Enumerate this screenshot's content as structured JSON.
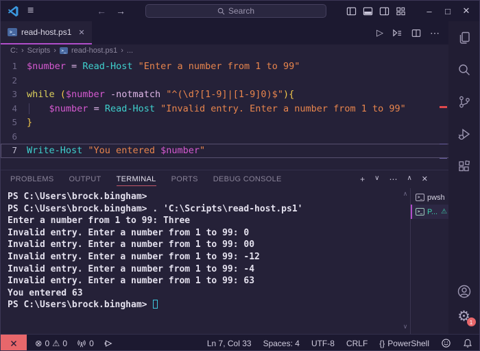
{
  "icons": {
    "menu": "≡",
    "back": "←",
    "forward": "→",
    "minimize": "–",
    "maximize": "□",
    "close": "✕",
    "play": "▷",
    "ellipsis": "⋯",
    "plus": "+",
    "chevron_down": "∨",
    "chevron_up": "∧",
    "error": "⊗",
    "warning": "⚠",
    "gear": "⚙",
    "braces": "{}",
    "sep": "›",
    "tab_close": "✕",
    "ps_glyph": ">_"
  },
  "titlebar": {
    "search_placeholder": "Search"
  },
  "editor_tab": {
    "label": "read-host.ps1"
  },
  "breadcrumb": {
    "drive": "C:",
    "folder": "Scripts",
    "file": "read-host.ps1",
    "more": "..."
  },
  "editor": {
    "lines": [
      {
        "n": 1,
        "tokens": [
          [
            "var",
            "$number"
          ],
          [
            "pln",
            " "
          ],
          [
            "op",
            "="
          ],
          [
            "pln",
            " "
          ],
          [
            "cmd",
            "Read-Host"
          ],
          [
            "pln",
            " "
          ],
          [
            "str",
            "\"Enter a number from 1 to 99\""
          ]
        ]
      },
      {
        "n": 2,
        "tokens": []
      },
      {
        "n": 3,
        "tokens": [
          [
            "kw",
            "while"
          ],
          [
            "pln",
            " "
          ],
          [
            "par",
            "("
          ],
          [
            "var",
            "$number"
          ],
          [
            "pln",
            " "
          ],
          [
            "op",
            "-notmatch"
          ],
          [
            "pln",
            " "
          ],
          [
            "str",
            "\"^(\\d?[1-9]|[1-9]0)$\""
          ],
          [
            "par",
            "){"
          ]
        ]
      },
      {
        "n": 4,
        "guide": true,
        "tokens": [
          [
            "pln",
            "    "
          ],
          [
            "var",
            "$number"
          ],
          [
            "pln",
            " "
          ],
          [
            "op",
            "="
          ],
          [
            "pln",
            " "
          ],
          [
            "cmd",
            "Read-Host"
          ],
          [
            "pln",
            " "
          ],
          [
            "str",
            "\"Invalid entry. Enter a number from 1 to 99\""
          ]
        ]
      },
      {
        "n": 5,
        "tokens": [
          [
            "par",
            "}"
          ]
        ]
      },
      {
        "n": 6,
        "tokens": []
      },
      {
        "n": 7,
        "current": true,
        "tokens": [
          [
            "cmd",
            "Write-Host"
          ],
          [
            "pln",
            " "
          ],
          [
            "str",
            "\"You entered "
          ],
          [
            "var",
            "$number"
          ],
          [
            "str",
            "\""
          ]
        ]
      }
    ]
  },
  "panel": {
    "tabs": [
      {
        "label": "PROBLEMS",
        "active": false
      },
      {
        "label": "OUTPUT",
        "active": false
      },
      {
        "label": "TERMINAL",
        "active": true
      },
      {
        "label": "PORTS",
        "active": false
      },
      {
        "label": "DEBUG CONSOLE",
        "active": false
      }
    ]
  },
  "terminal": {
    "lines": [
      "PS C:\\Users\\brock.bingham>",
      "PS C:\\Users\\brock.bingham> . 'C:\\Scripts\\read-host.ps1'",
      "Enter a number from 1 to 99: Three",
      "Invalid entry. Enter a number from 1 to 99: 0",
      "Invalid entry. Enter a number from 1 to 99: 00",
      "Invalid entry. Enter a number from 1 to 99: -12",
      "Invalid entry. Enter a number from 1 to 99: -4",
      "Invalid entry. Enter a number from 1 to 99: 63",
      "You entered 63",
      "PS C:\\Users\\brock.bingham> "
    ],
    "list": [
      {
        "label": "pwsh",
        "selected": false,
        "warning": false
      },
      {
        "label": "P...",
        "selected": true,
        "warning": true
      }
    ]
  },
  "statusbar": {
    "errors": "0",
    "warnings": "0",
    "ports": "0",
    "line_col": "Ln 7, Col 33",
    "spaces": "Spaces: 4",
    "encoding": "UTF-8",
    "eol": "CRLF",
    "language": "PowerShell"
  },
  "settings_badge": "1"
}
